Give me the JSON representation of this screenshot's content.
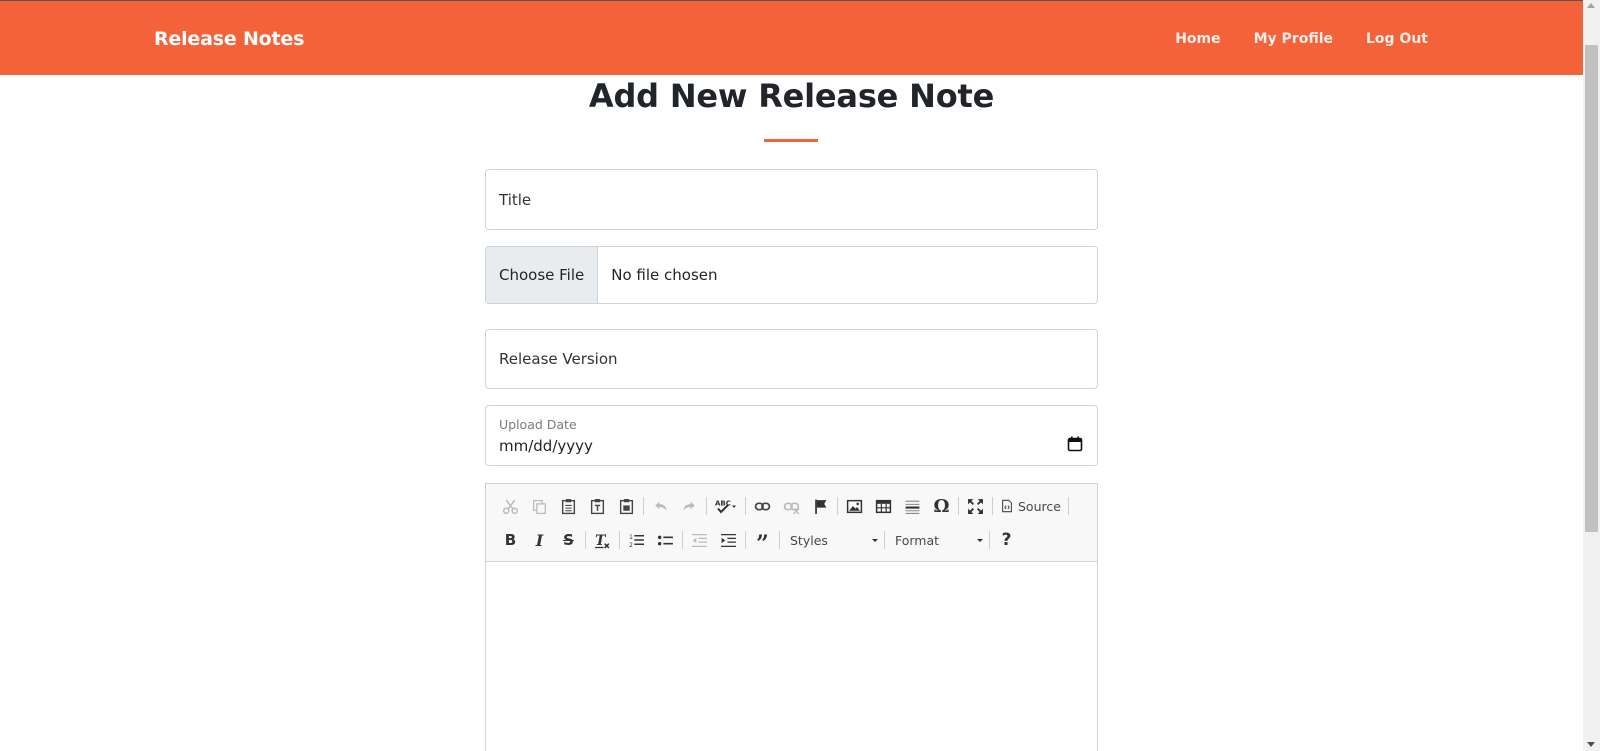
{
  "navbar": {
    "brand": "Release Notes",
    "links": [
      "Home",
      "My Profile",
      "Log Out"
    ],
    "color": "#f4623a"
  },
  "page": {
    "title": "Add New Release Note"
  },
  "form": {
    "title_placeholder": "Title",
    "file_button": "Choose File",
    "file_status": "No file chosen",
    "version_placeholder": "Release Version",
    "date_label": "Upload Date",
    "date_value": "mm/dd/yyyy"
  },
  "editor": {
    "source_label": "Source",
    "styles_label": "Styles",
    "format_label": "Format",
    "icons_row1": [
      "cut-icon",
      "copy-icon",
      "paste-icon",
      "paste-text-icon",
      "paste-word-icon",
      "undo-icon",
      "redo-icon",
      "spellcheck-icon",
      "link-icon",
      "unlink-icon",
      "anchor-icon",
      "image-icon",
      "table-icon",
      "horizontal-line-icon",
      "special-char-icon",
      "maximize-icon",
      "source-icon"
    ],
    "icons_row2": [
      "bold-icon",
      "italic-icon",
      "strike-icon",
      "remove-format-icon",
      "numbered-list-icon",
      "bulleted-list-icon",
      "outdent-icon",
      "indent-icon",
      "blockquote-icon",
      "help-icon"
    ]
  }
}
